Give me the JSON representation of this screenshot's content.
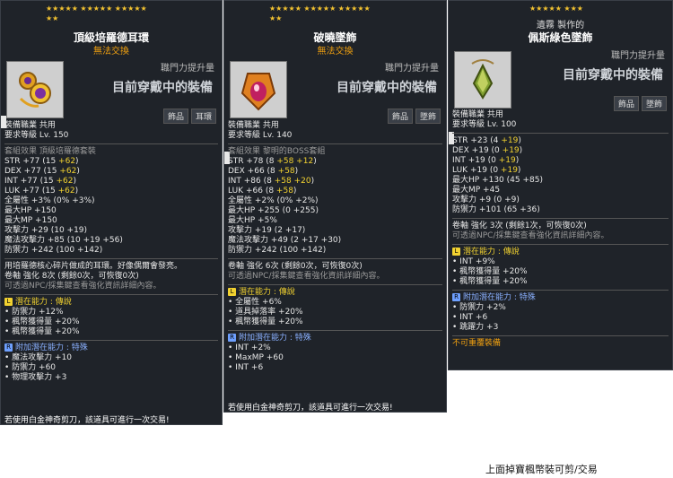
{
  "panels": [
    {
      "stars": "★★★★★  ★★★★★  ★★★★★",
      "stars2": "★★",
      "title": "頂級培羅德耳環",
      "subtitle": "無法交換",
      "power": "職門力提升量",
      "wearing": "目前穿戴中的裝備",
      "chips": [
        "飾品",
        "耳環"
      ],
      "job": "裝備職業        共用",
      "level": "要求等級        Lv. 150",
      "set": "套組效果        頂級培羅德套裝",
      "stats": [
        [
          "STR",
          "+77",
          "(15 ",
          "+62",
          ")"
        ],
        [
          "DEX",
          "+77",
          "(15 ",
          "+62",
          ")"
        ],
        [
          "INT",
          "+77",
          "(15 ",
          "+62",
          ")"
        ],
        [
          "LUK",
          "+77",
          "(15 ",
          "+62",
          ")"
        ]
      ],
      "extra": [
        "全屬性  +3% (0% +3%)",
        "最大HP  +150",
        "最大MP  +150",
        "攻擊力  +29 (10 +19)",
        "魔法攻擊力  +85 (10 +19 +56)",
        "防禦力  +242 (100 +142)"
      ],
      "desc": "用培羅德核心碎片做成的耳環。好像偶爾會發亮。",
      "scroll": "卷軸 強化 8次 (剩餘0次，可恢復0次)",
      "npc": "可透過NPC/採集鍵查看強化資訊詳細內容。",
      "pot_title": "潛在能力 : 傳說",
      "pot": [
        "防禦力 +12%",
        "楓幣獲得量 +20%",
        "楓幣獲得量 +20%"
      ],
      "add_title": "附加潛在能力 : 特殊",
      "add": [
        "魔法攻擊力 +10",
        "防禦力 +60",
        "物理攻擊力 +3"
      ],
      "foot": "若使用白金神奇剪刀，該道具可進行一次交易!"
    },
    {
      "stars": "★★★★★  ★★★★★  ★★★★★",
      "stars2": "★★",
      "title": "破曉墜飾",
      "subtitle": "無法交換",
      "power": "職門力提升量",
      "wearing": "目前穿戴中的裝備",
      "chips": [
        "飾品",
        "墜飾"
      ],
      "job": "裝備職業        共用",
      "level": "要求等級        Lv. 140",
      "set": "套組效果        黎明的BOSS套組",
      "stats": [
        [
          "STR",
          "+78",
          "(8 ",
          "+58 +12",
          ")"
        ],
        [
          "DEX",
          "+66",
          "(8 ",
          "+58",
          ")"
        ],
        [
          "INT",
          "+86",
          "(8 ",
          "+58 +20",
          ")"
        ],
        [
          "LUK",
          "+66",
          "(8 ",
          "+58",
          ")"
        ]
      ],
      "extra": [
        "全屬性  +2% (0% +2%)",
        "最大HP  +255 (0 +255)",
        "最大HP  +5%",
        "攻擊力  +19 (2 +17)",
        "魔法攻擊力  +49 (2 +17 +30)",
        "防禦力  +242 (100 +142)"
      ],
      "scroll": "卷軸 強化 6次 (剩餘0次，可恢復0次)",
      "npc": "可透過NPC/採集鍵查看強化資訊詳細內容。",
      "pot_title": "潛在能力 : 傳說",
      "pot": [
        "全屬性 +6%",
        "道具掉落率 +20%",
        "楓幣獲得量 +20%"
      ],
      "add_title": "附加潛在能力 : 特殊",
      "add": [
        "INT +2%",
        "MaxMP +60",
        "INT +6"
      ],
      "foot": "若使用白金神奇剪刀，該道具可進行一次交易!"
    },
    {
      "stars": "★★★★★  ★★★",
      "crafted": "遺霧 製作的",
      "title": "佩斯綠色墜飾",
      "power": "職門力提升量",
      "wearing": "目前穿戴中的裝備",
      "chips": [
        "飾品",
        "墜飾"
      ],
      "job": "裝備職業        共用",
      "level": "要求等級        Lv. 100",
      "stats": [
        [
          "STR",
          "+23",
          "(4 ",
          "+19",
          ")"
        ],
        [
          "DEX",
          "+19",
          "(0 ",
          "+19",
          ")"
        ],
        [
          "INT",
          "+19",
          "(0 ",
          "+19",
          ")"
        ],
        [
          "LUK",
          "+19",
          "(0 ",
          "+19",
          ")"
        ]
      ],
      "extra": [
        "最大HP  +130 (45 +85)",
        "最大MP  +45",
        "攻擊力  +9 (0 +9)",
        "防禦力  +101 (65 +36)"
      ],
      "scroll": "卷軸 強化 3次 (剩餘1次，可恢復0次)",
      "npc": "可透過NPC/採集鍵查看強化資訊詳細內容。",
      "pot_title": "潛在能力 : 傳說",
      "pot": [
        "INT +9%",
        "楓幣獲得量 +20%",
        "楓幣獲得量 +20%"
      ],
      "add_title": "附加潛在能力 : 特殊",
      "add": [
        "防禦力 +2%",
        "INT +6",
        "跳躍力 +3"
      ],
      "foot": "不可重覆裝備"
    }
  ],
  "caption": "上面掉寶楓幣裝可剪/交易",
  "colors": {
    "panel_bg": "#1f2329",
    "gold": "#f2d230",
    "bonus": "#60d060",
    "blue": "#8ab0ff",
    "orange": "#f0a010"
  }
}
